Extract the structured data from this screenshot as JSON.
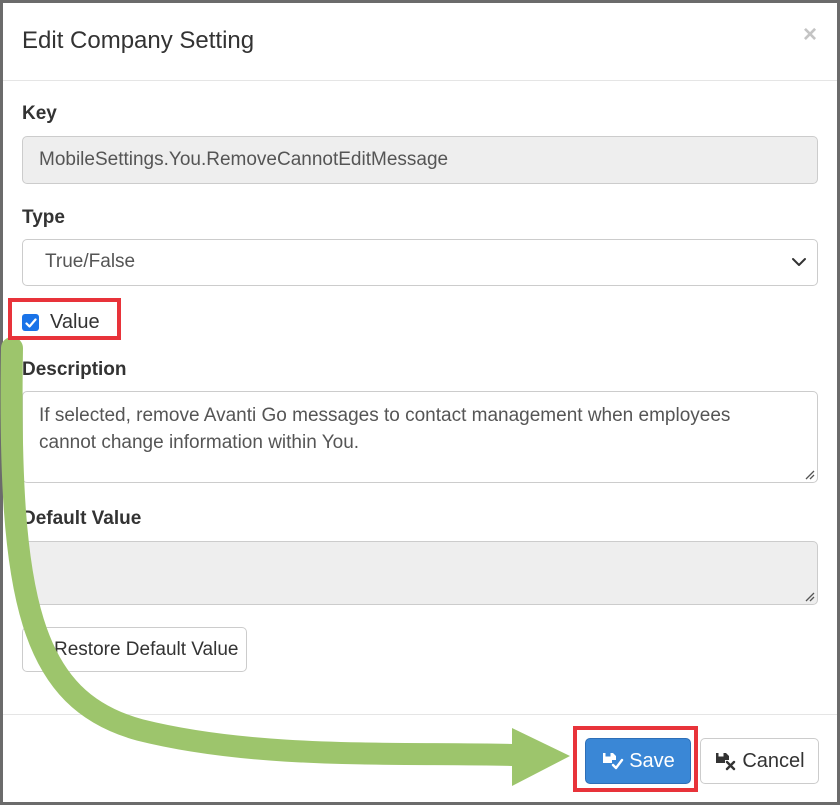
{
  "dialog": {
    "title": "Edit Company Setting",
    "close_label": "×"
  },
  "form": {
    "key": {
      "label": "Key",
      "value": "MobileSettings.You.RemoveCannotEditMessage"
    },
    "type": {
      "label": "Type",
      "selected": "True/False"
    },
    "value": {
      "label": "Value",
      "checked": true
    },
    "description": {
      "label": "Description",
      "line1": "If selected, remove Avanti Go messages to contact management when employees",
      "line2": "cannot change information within You."
    },
    "default_value": {
      "label": "Default Value",
      "value": ""
    },
    "restore_label": "Restore Default Value"
  },
  "footer": {
    "save_label": "Save",
    "cancel_label": "Cancel"
  },
  "colors": {
    "highlight": "#e8333a",
    "arrow": "#9dc56c",
    "primary": "#3a87d6"
  }
}
